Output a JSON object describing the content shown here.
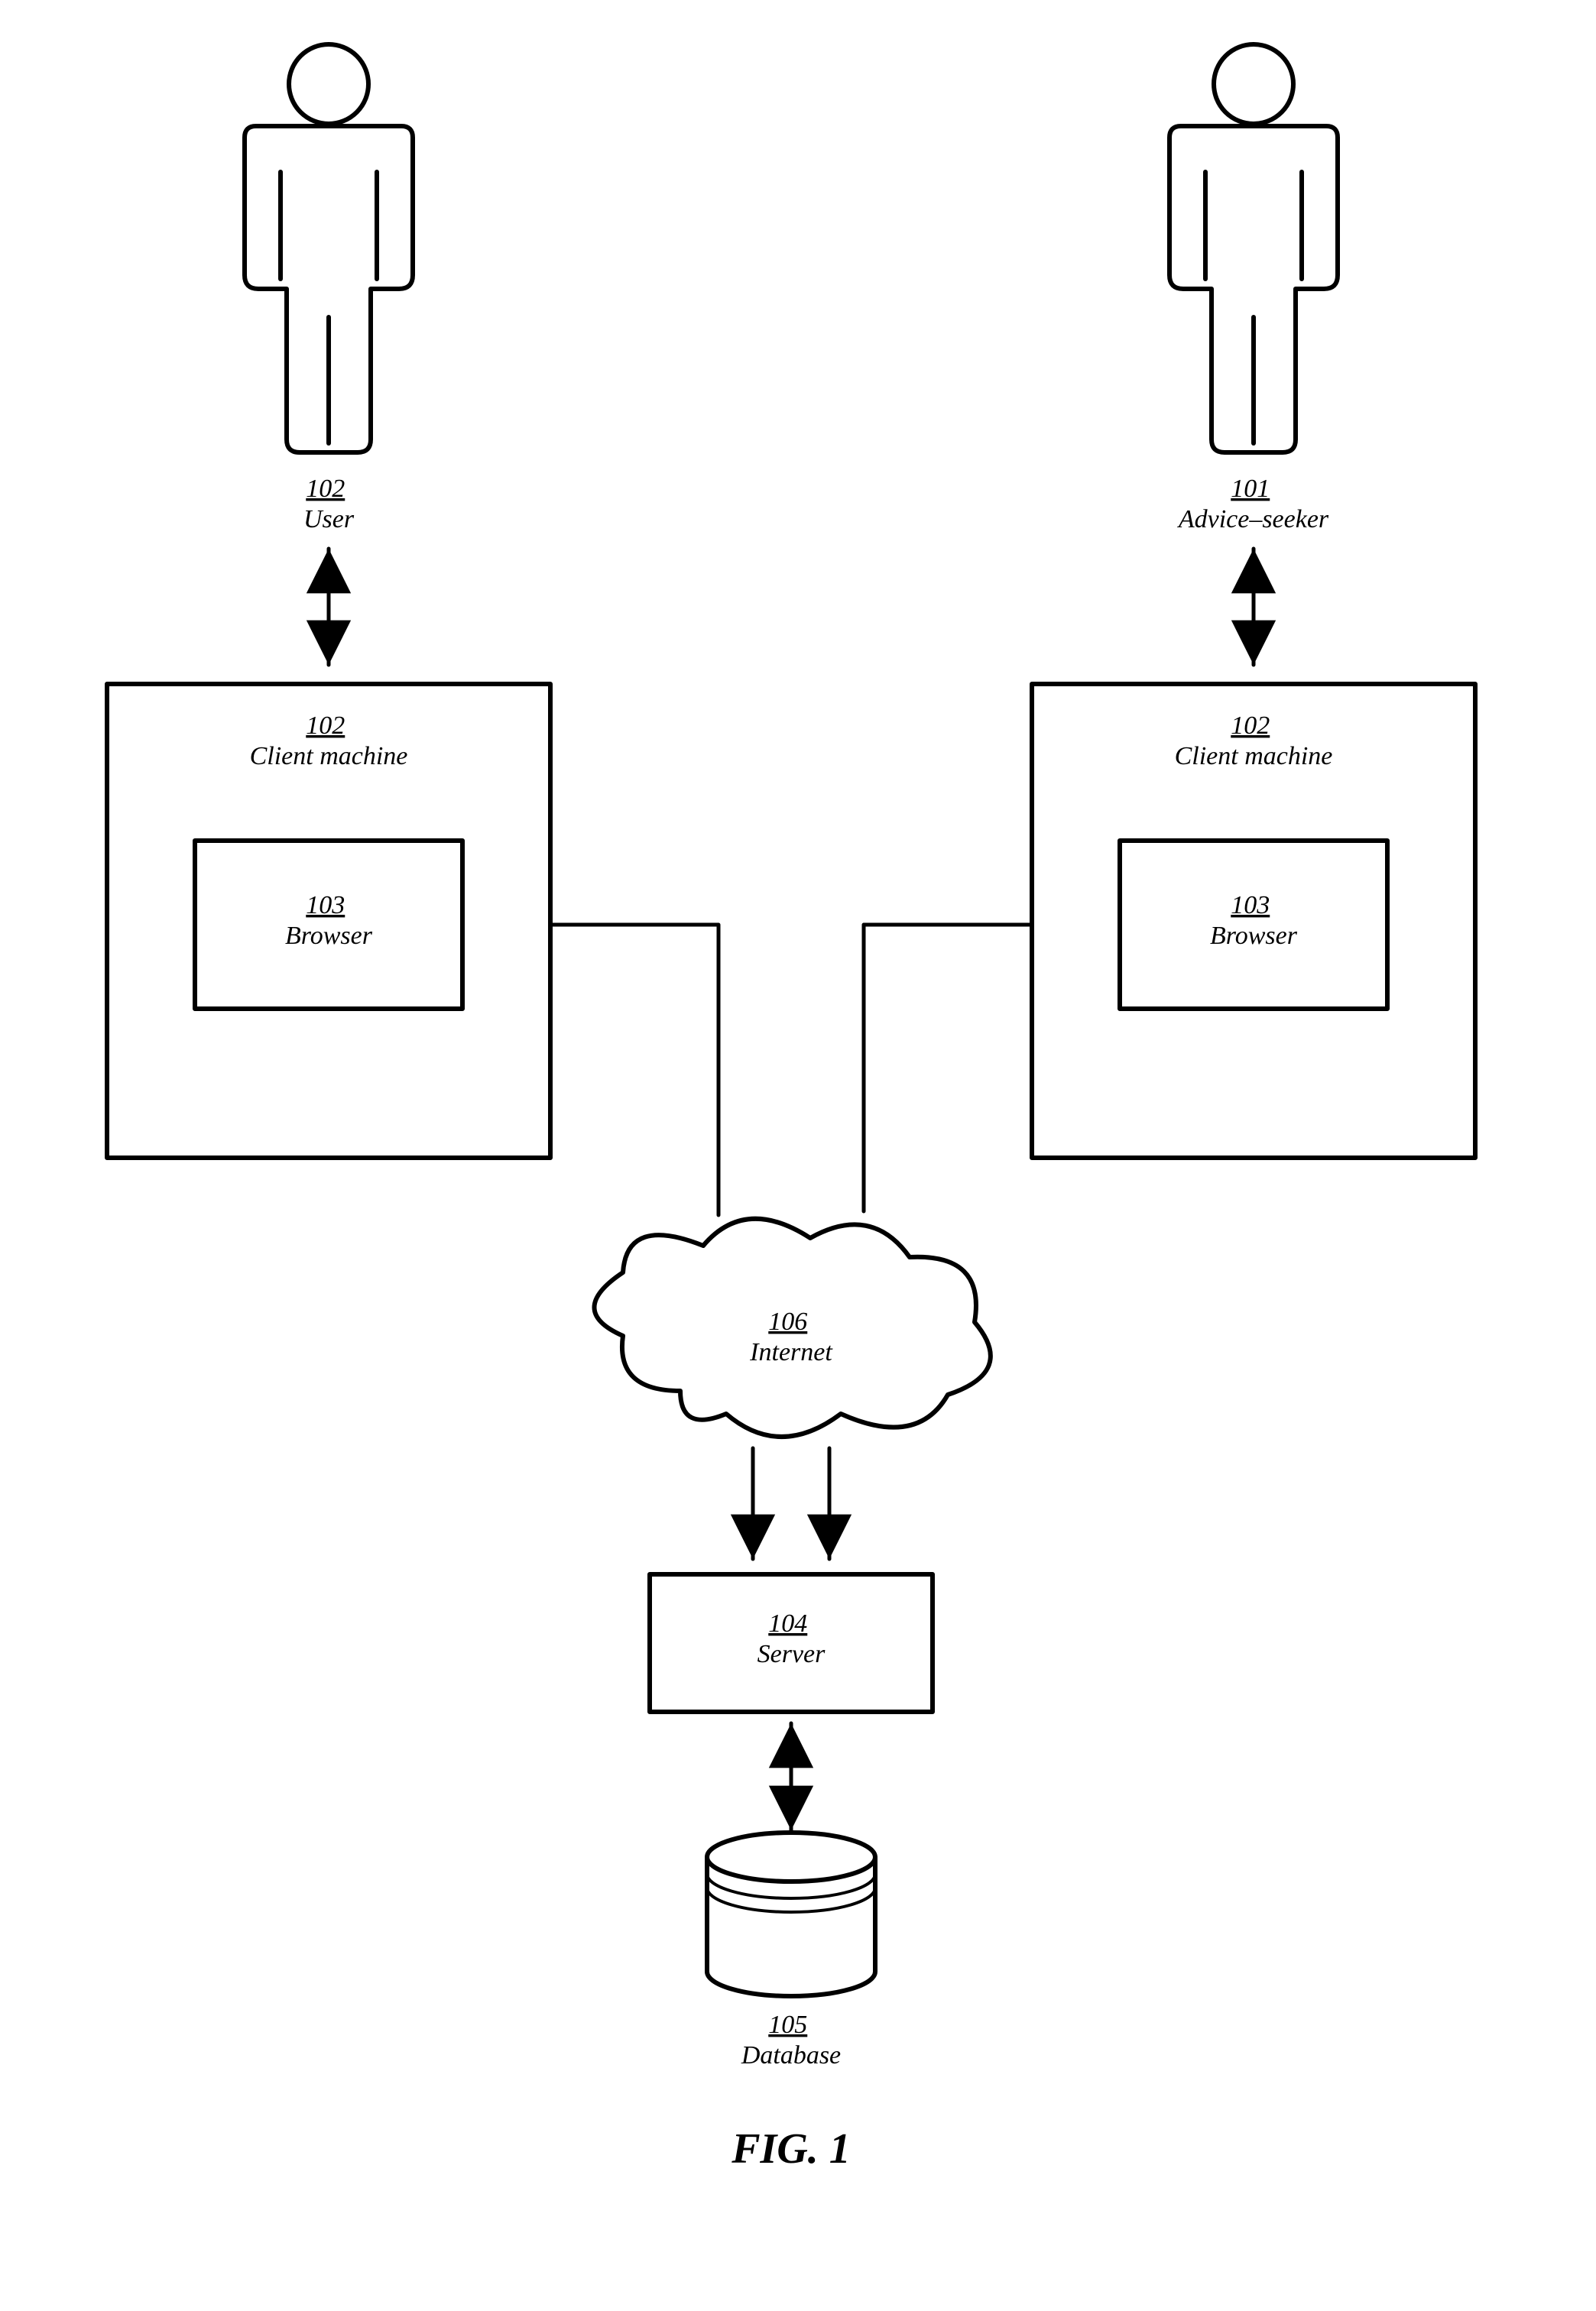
{
  "figure_label": "FIG. 1",
  "nodes": {
    "user": {
      "ref": "102",
      "name": "User"
    },
    "advice_seeker": {
      "ref": "101",
      "name": "Advice–seeker"
    },
    "client_left": {
      "ref": "102",
      "name": "Client machine"
    },
    "client_right": {
      "ref": "102",
      "name": "Client machine"
    },
    "browser_left": {
      "ref": "103",
      "name": "Browser"
    },
    "browser_right": {
      "ref": "103",
      "name": "Browser"
    },
    "internet": {
      "ref": "106",
      "name": "Internet"
    },
    "server": {
      "ref": "104",
      "name": "Server"
    },
    "database": {
      "ref": "105",
      "name": "Database"
    }
  },
  "edges": [
    {
      "from": "user",
      "to": "client_left",
      "dir": "both"
    },
    {
      "from": "advice_seeker",
      "to": "client_right",
      "dir": "both"
    },
    {
      "from": "client_left",
      "to": "internet",
      "dir": "none"
    },
    {
      "from": "client_right",
      "to": "internet",
      "dir": "none"
    },
    {
      "from": "internet",
      "to": "server",
      "dir": "to",
      "count": 2
    },
    {
      "from": "server",
      "to": "database",
      "dir": "both"
    }
  ]
}
